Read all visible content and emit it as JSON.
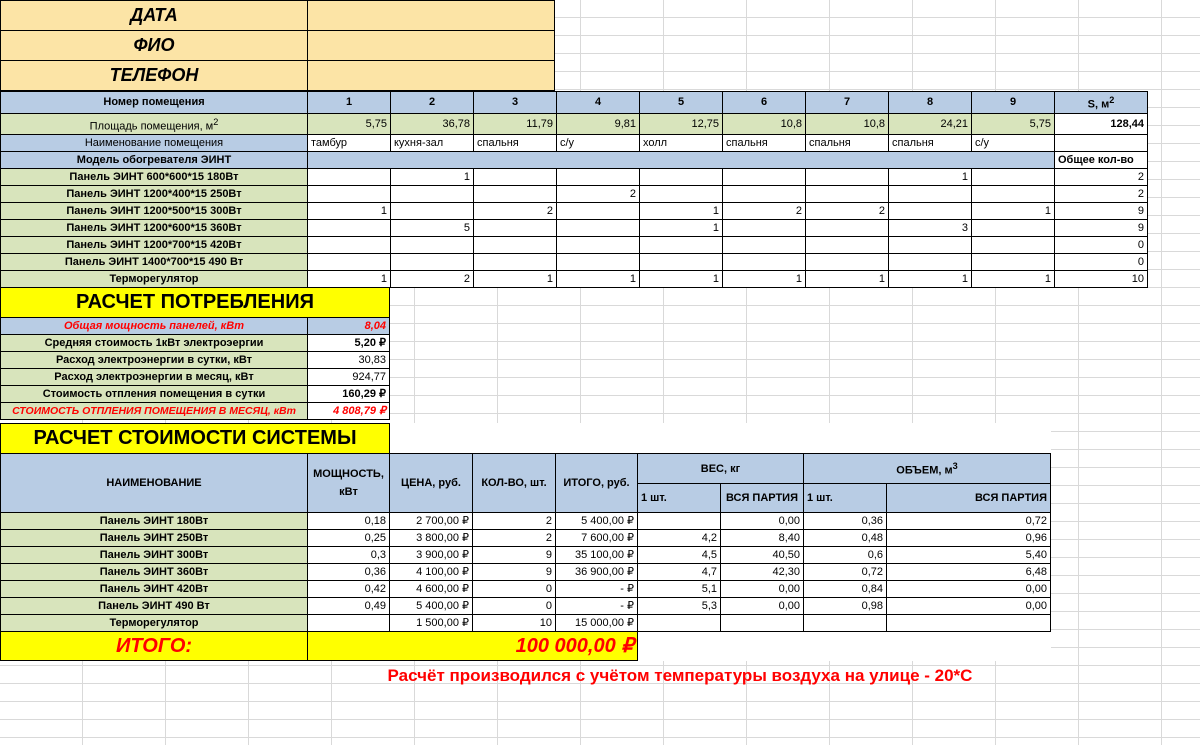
{
  "contact": {
    "date_label": "ДАТА",
    "fio_label": "ФИО",
    "phone_label": "ТЕЛЕФОН"
  },
  "rooms": {
    "room_number_label": "Номер помещения",
    "area_label": "Площадь помещения, м",
    "area_sup": "2",
    "name_label": "Наименование помещения",
    "numbers": [
      "1",
      "2",
      "3",
      "4",
      "5",
      "6",
      "7",
      "8",
      "9"
    ],
    "total_area_label": "S, м",
    "total_area_sup": "2",
    "areas": [
      "5,75",
      "36,78",
      "11,79",
      "9,81",
      "12,75",
      "10,8",
      "10,8",
      "24,21",
      "5,75"
    ],
    "total_area": "128,44",
    "names": [
      "тамбур",
      "кухня-зал",
      "спальня",
      "с/у",
      "холл",
      "спальня",
      "спальня",
      "спальня",
      "с/у"
    ]
  },
  "models": {
    "header_label": "Модель обогревателя ЭИНТ",
    "total_label": "Общее кол-во",
    "rows": [
      {
        "name": "Панель ЭИНТ 600*600*15 180Вт",
        "cells": [
          "",
          "1",
          "",
          "",
          "",
          "",
          "",
          "1",
          ""
        ],
        "total": "2"
      },
      {
        "name": "Панель ЭИНТ 1200*400*15 250Вт",
        "cells": [
          "",
          "",
          "",
          "2",
          "",
          "",
          "",
          "",
          ""
        ],
        "total": "2"
      },
      {
        "name": "Панель ЭИНТ 1200*500*15 300Вт",
        "cells": [
          "1",
          "",
          "2",
          "",
          "1",
          "2",
          "2",
          "",
          "1"
        ],
        "total": "9"
      },
      {
        "name": "Панель ЭИНТ 1200*600*15 360Вт",
        "cells": [
          "",
          "5",
          "",
          "",
          "1",
          "",
          "",
          "3",
          ""
        ],
        "total": "9"
      },
      {
        "name": "Панель ЭИНТ 1200*700*15 420Вт",
        "cells": [
          "",
          "",
          "",
          "",
          "",
          "",
          "",
          "",
          ""
        ],
        "total": "0"
      },
      {
        "name": "Панель ЭИНТ 1400*700*15 490 Вт",
        "cells": [
          "",
          "",
          "",
          "",
          "",
          "",
          "",
          "",
          ""
        ],
        "total": "0"
      },
      {
        "name": "Терморегулятор",
        "cells": [
          "1",
          "2",
          "1",
          "1",
          "1",
          "1",
          "1",
          "1",
          "1"
        ],
        "total": "10"
      }
    ]
  },
  "consumption": {
    "title": "РАСЧЕТ ПОТРЕБЛЕНИЯ",
    "rows": [
      {
        "label": "Общая мощность панелей, кВт",
        "value": "8,04"
      },
      {
        "label": "Средняя стоимость 1кВт электроэергии",
        "value": "5,20 ₽"
      },
      {
        "label": "Расход электроэнергии в сутки, кВт",
        "value": "30,83"
      },
      {
        "label": "Расход электроэнергии в месяц, кВт",
        "value": "924,77"
      },
      {
        "label": "Стоимость отпления помещения в сутки",
        "value": "160,29 ₽"
      },
      {
        "label": "СТОИМОСТЬ ОТПЛЕНИЯ ПОМЕЩЕНИЯ В МЕСЯЦ, кВт",
        "value": "4 808,79 ₽"
      }
    ]
  },
  "cost": {
    "title": "РАСЧЕТ СТОИМОСТИ СИСТЕМЫ",
    "headers": {
      "name": "НАИМЕНОВАНИЕ",
      "power": "МОЩНОСТЬ, кВт",
      "price": "ЦЕНА, руб.",
      "qty": "КОЛ-ВО, шт.",
      "total": "ИТОГО, руб.",
      "weight": "ВЕС, кг",
      "volume": "ОБЪЕМ, м",
      "volume_sup": "3",
      "one": "1 шт.",
      "batch": "ВСЯ ПАРТИЯ"
    },
    "rows": [
      {
        "name": "Панель ЭИНТ 180Вт",
        "power": "0,18",
        "price": "2 700,00 ₽",
        "qty": "2",
        "total": "5 400,00 ₽",
        "w1": "",
        "wb": "0,00",
        "v1": "0,36",
        "vb": "0,72"
      },
      {
        "name": "Панель ЭИНТ 250Вт",
        "power": "0,25",
        "price": "3 800,00 ₽",
        "qty": "2",
        "total": "7 600,00 ₽",
        "w1": "4,2",
        "wb": "8,40",
        "v1": "0,48",
        "vb": "0,96"
      },
      {
        "name": "Панель ЭИНТ 300Вт",
        "power": "0,3",
        "price": "3 900,00 ₽",
        "qty": "9",
        "total": "35 100,00 ₽",
        "w1": "4,5",
        "wb": "40,50",
        "v1": "0,6",
        "vb": "5,40"
      },
      {
        "name": "Панель ЭИНТ 360Вт",
        "power": "0,36",
        "price": "4 100,00 ₽",
        "qty": "9",
        "total": "36 900,00 ₽",
        "w1": "4,7",
        "wb": "42,30",
        "v1": "0,72",
        "vb": "6,48"
      },
      {
        "name": "Панель ЭИНТ 420Вт",
        "power": "0,42",
        "price": "4 600,00 ₽",
        "qty": "0",
        "total": "-    ₽",
        "w1": "5,1",
        "wb": "0,00",
        "v1": "0,84",
        "vb": "0,00"
      },
      {
        "name": "Панель ЭИНТ 490 Вт",
        "power": "0,49",
        "price": "5 400,00 ₽",
        "qty": "0",
        "total": "-    ₽",
        "w1": "5,3",
        "wb": "0,00",
        "v1": "0,98",
        "vb": "0,00"
      },
      {
        "name": "Терморегулятор",
        "power": "",
        "price": "1 500,00 ₽",
        "qty": "10",
        "total": "15 000,00 ₽",
        "w1": "",
        "wb": "",
        "v1": "",
        "vb": ""
      }
    ],
    "grand_total_label": "ИТОГО:",
    "grand_total_value": "100 000,00 ₽"
  },
  "note": "Расчёт производился с учётом температуры воздуха на улице - 20*С"
}
